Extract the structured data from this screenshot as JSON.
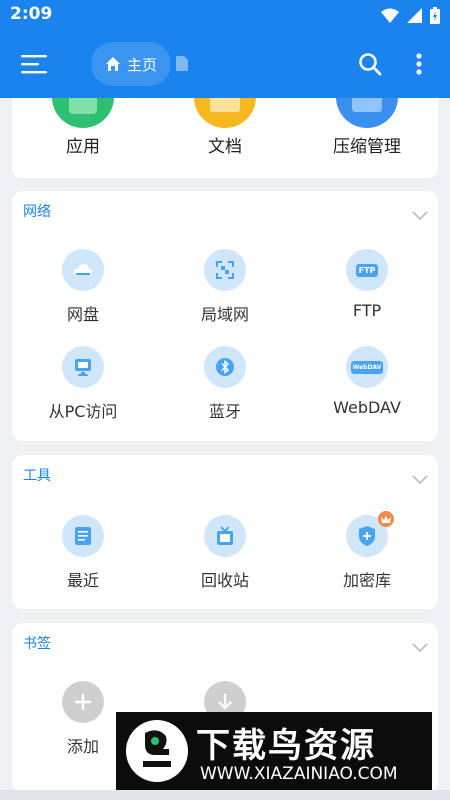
{
  "status_bar": {
    "time": "2:09"
  },
  "header": {
    "home_label": "主页"
  },
  "top_section": {
    "items": [
      {
        "label": "应用",
        "color": "#2fbf71"
      },
      {
        "label": "文档",
        "color": "#f6b81c"
      },
      {
        "label": "压缩管理",
        "color": "#3a8fef"
      }
    ]
  },
  "network": {
    "title": "网络",
    "items": [
      {
        "label": "网盘",
        "icon": "cloud-icon"
      },
      {
        "label": "局域网",
        "icon": "lan-icon"
      },
      {
        "label": "FTP",
        "icon": "ftp-icon",
        "badge": "FTP"
      },
      {
        "label": "从PC访问",
        "icon": "monitor-icon"
      },
      {
        "label": "蓝牙",
        "icon": "bluetooth-icon"
      },
      {
        "label": "WebDAV",
        "icon": "webdav-icon",
        "badge": "WebDAV"
      }
    ]
  },
  "tools": {
    "title": "工具",
    "items": [
      {
        "label": "最近",
        "icon": "document-icon"
      },
      {
        "label": "回收站",
        "icon": "recycle-icon"
      },
      {
        "label": "加密库",
        "icon": "shield-plus-icon"
      }
    ]
  },
  "bookmarks": {
    "title": "书签",
    "items": [
      {
        "label": "添加",
        "icon": "plus-icon"
      },
      {
        "label": "",
        "icon": "download-icon"
      }
    ]
  },
  "watermark": {
    "title": "下载鸟资源",
    "url": "WWW.XIAZAINIAO.COM"
  },
  "colors": {
    "accent": "#1a83ee",
    "icon_bg": "#cfe6fb",
    "icon_fg": "#4aa3f2"
  }
}
